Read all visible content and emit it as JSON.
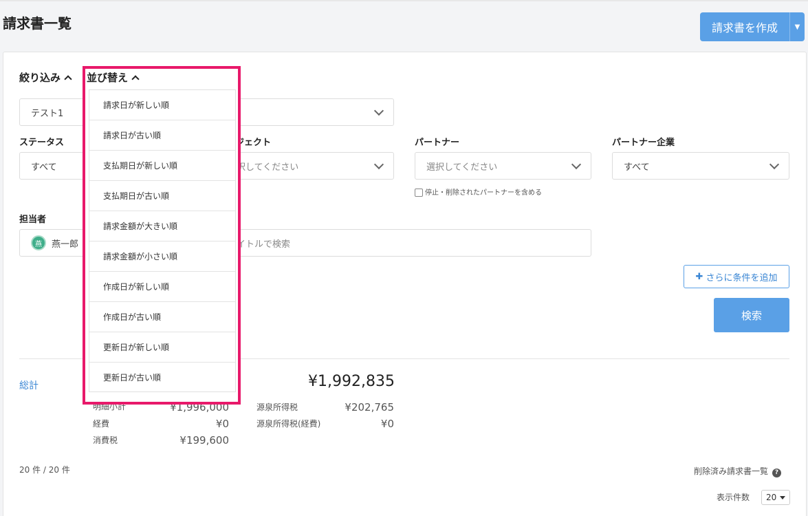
{
  "header": {
    "title": "請求書一覧",
    "create_label": "請求書を作成"
  },
  "filters": {
    "filter_toggle": "絞り込み",
    "sort_toggle": "並び替え",
    "saved_condition_value": "テスト1",
    "status_label": "ステータス",
    "status_value": "すべて",
    "project_label_partial": "ジェクト",
    "project_placeholder_partial": "択してください",
    "partner_label": "パートナー",
    "partner_placeholder": "選択してください",
    "partner_include_deleted": "停止・削除されたパートナーを含める",
    "partner_company_label": "パートナー企業",
    "partner_company_value": "すべて",
    "assignee_label": "担当者",
    "assignee_avatar": "燕",
    "assignee_name": "燕一郎",
    "title_search_placeholder_partial": "イトルで検索",
    "add_condition_label": "さらに条件を追加",
    "search_label": "検索"
  },
  "sort_options": [
    "請求日が新しい順",
    "請求日が古い順",
    "支払期日が新しい順",
    "支払期日が古い順",
    "請求金額が大きい順",
    "請求金額が小さい順",
    "作成日が新しい順",
    "作成日が古い順",
    "更新日が新しい順",
    "更新日が古い順"
  ],
  "totals": {
    "label": "総計",
    "grand_total": "¥1,992,835",
    "subtotal_label_partial": "明細小計",
    "subtotal_value": "¥1,996,000",
    "expenses_label": "経費",
    "expenses_value": "¥0",
    "consumption_tax_label": "消費税",
    "consumption_tax_value": "¥199,600",
    "withholding_label": "源泉所得税",
    "withholding_value": "¥202,765",
    "withholding_exp_label": "源泉所得税(経費)",
    "withholding_exp_value": "¥0"
  },
  "footer": {
    "count_text": "20 件 / 20 件",
    "deleted_link": "削除済み請求書一覧",
    "per_page_label": "表示件数",
    "per_page_value": "20"
  },
  "colors": {
    "accent": "#5aa0e6",
    "highlight": "#e8196a",
    "avatar": "#3fae8a"
  }
}
